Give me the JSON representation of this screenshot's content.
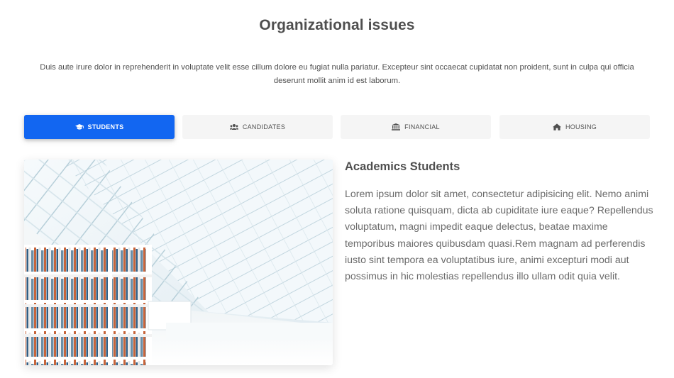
{
  "page": {
    "title": "Organizational issues",
    "intro": "Duis aute irure dolor in reprehenderit in voluptate velit esse cillum dolore eu fugiat nulla pariatur. Excepteur sint occaecat cupidatat non proident, sunt in culpa qui officia deserunt mollit anim id est laborum."
  },
  "tabs": [
    {
      "label": "STUDENTS",
      "icon": "graduation-cap-icon",
      "active": true
    },
    {
      "label": "CANDIDATES",
      "icon": "users-icon",
      "active": false
    },
    {
      "label": "FINANCIAL",
      "icon": "bank-icon",
      "active": false
    },
    {
      "label": "HOUSING",
      "icon": "home-icon",
      "active": false
    }
  ],
  "content": {
    "heading": "Academics Students",
    "body": "Lorem ipsum dolor sit amet, consectetur adipisicing elit. Nemo animi soluta ratione quisquam, dicta ab cupiditate iure eaque? Repellendus voluptatum, magni impedit eaque delectus, beatae maxime temporibus maiores quibusdam quasi.Rem magnam ad perferendis iusto sint tempora ea voluptatibus iure, animi excepturi modi aut possimus in hic molestias repellendus illo ullam odit quia velit."
  },
  "colors": {
    "accent": "#1266f1",
    "tab_bg": "#f5f5f5",
    "text": "#4f4f4f"
  }
}
